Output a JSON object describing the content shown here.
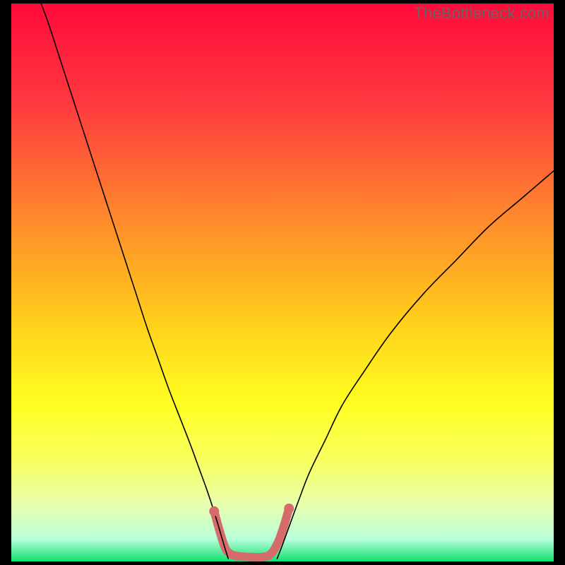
{
  "watermark": "TheBottleneck.com",
  "chart_data": {
    "type": "line",
    "title": "",
    "xlabel": "",
    "ylabel": "",
    "xlim": [
      0,
      100
    ],
    "ylim": [
      0,
      100
    ],
    "gradient_stops": [
      {
        "offset": 0,
        "color": "#ff0a3a"
      },
      {
        "offset": 18,
        "color": "#ff3a3f"
      },
      {
        "offset": 40,
        "color": "#ff8f2a"
      },
      {
        "offset": 58,
        "color": "#ffd21a"
      },
      {
        "offset": 72,
        "color": "#ffff22"
      },
      {
        "offset": 82,
        "color": "#f7ff60"
      },
      {
        "offset": 90,
        "color": "#e8ffb0"
      },
      {
        "offset": 96,
        "color": "#b8ffda"
      },
      {
        "offset": 100,
        "color": "#10e070"
      }
    ],
    "series": [
      {
        "name": "left-curve",
        "color": "#000000",
        "width": 1.6,
        "points": [
          {
            "x": 5.5,
            "y": 100
          },
          {
            "x": 7,
            "y": 96
          },
          {
            "x": 9,
            "y": 90
          },
          {
            "x": 11,
            "y": 84
          },
          {
            "x": 13,
            "y": 78
          },
          {
            "x": 15,
            "y": 72
          },
          {
            "x": 17,
            "y": 66
          },
          {
            "x": 19,
            "y": 60
          },
          {
            "x": 21,
            "y": 54
          },
          {
            "x": 23,
            "y": 48
          },
          {
            "x": 25,
            "y": 42
          },
          {
            "x": 27,
            "y": 36.5
          },
          {
            "x": 29,
            "y": 31
          },
          {
            "x": 31,
            "y": 26
          },
          {
            "x": 33,
            "y": 21
          },
          {
            "x": 34.5,
            "y": 17
          },
          {
            "x": 36,
            "y": 13
          },
          {
            "x": 37.2,
            "y": 9.5
          },
          {
            "x": 38.3,
            "y": 6
          },
          {
            "x": 39.2,
            "y": 3
          },
          {
            "x": 40,
            "y": 0.5
          }
        ]
      },
      {
        "name": "right-curve",
        "color": "#000000",
        "width": 1.6,
        "points": [
          {
            "x": 49,
            "y": 0.5
          },
          {
            "x": 50,
            "y": 3
          },
          {
            "x": 51.5,
            "y": 7
          },
          {
            "x": 53,
            "y": 11
          },
          {
            "x": 55,
            "y": 16
          },
          {
            "x": 58,
            "y": 22
          },
          {
            "x": 61,
            "y": 28
          },
          {
            "x": 65,
            "y": 34
          },
          {
            "x": 70,
            "y": 41
          },
          {
            "x": 76,
            "y": 48
          },
          {
            "x": 82,
            "y": 54
          },
          {
            "x": 88,
            "y": 60
          },
          {
            "x": 94,
            "y": 65
          },
          {
            "x": 100,
            "y": 70
          }
        ]
      },
      {
        "name": "valley-highlight",
        "color": "#d66b6b",
        "width": 12,
        "linecap": "round",
        "points": [
          {
            "x": 37.4,
            "y": 9
          },
          {
            "x": 38.4,
            "y": 5.5
          },
          {
            "x": 39.4,
            "y": 2.5
          },
          {
            "x": 40.2,
            "y": 1.5
          },
          {
            "x": 41.5,
            "y": 1.0
          },
          {
            "x": 44,
            "y": 0.8
          },
          {
            "x": 46.5,
            "y": 0.8
          },
          {
            "x": 48,
            "y": 1.5
          },
          {
            "x": 49.2,
            "y": 3.5
          },
          {
            "x": 50.3,
            "y": 6.5
          },
          {
            "x": 51.2,
            "y": 9.5
          }
        ]
      }
    ],
    "valley_markers": [
      {
        "x": 37.4,
        "y": 9,
        "r": 7,
        "color": "#d66b6b"
      },
      {
        "x": 51.2,
        "y": 9.5,
        "r": 7,
        "color": "#d66b6b"
      }
    ]
  }
}
